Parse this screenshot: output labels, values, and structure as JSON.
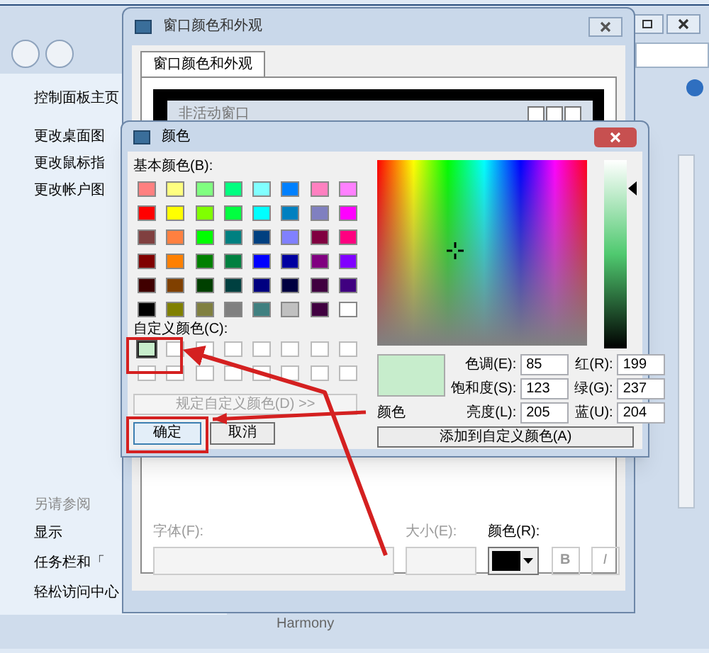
{
  "control_panel": {
    "sidebar_links": [
      "控制面板主页",
      "更改桌面图",
      "更改鼠标指",
      "更改帐户图"
    ],
    "see_also_title": "另请参阅",
    "see_also_links": [
      "显示",
      "任务栏和「",
      "轻松访问中心"
    ],
    "theme_name": "Harmony"
  },
  "appearance_dialog": {
    "title": "窗口颜色和外观",
    "tabs": [
      {
        "label": "窗口颜色和外观",
        "selected": true
      }
    ],
    "preview_window_title": "非活动窗口",
    "font_label": "字体(F):",
    "size_label": "大小(E):",
    "color_label": "颜色(R):",
    "bold_button": "B",
    "italic_button": "I"
  },
  "color_dialog": {
    "title": "颜色",
    "basic_colors_label": "基本颜色(B):",
    "basic_colors": [
      {
        "color": "#ff8080"
      },
      {
        "color": "#ffff80"
      },
      {
        "color": "#80ff80"
      },
      {
        "color": "#00ff80"
      },
      {
        "color": "#80ffff"
      },
      {
        "color": "#0080ff"
      },
      {
        "color": "#ff80c0"
      },
      {
        "color": "#ff80ff"
      },
      {
        "color": "#ff0000"
      },
      {
        "color": "#ffff00"
      },
      {
        "color": "#80ff00"
      },
      {
        "color": "#00ff40"
      },
      {
        "color": "#00ffff"
      },
      {
        "color": "#0080c0"
      },
      {
        "color": "#8080c0"
      },
      {
        "color": "#ff00ff"
      },
      {
        "color": "#804040"
      },
      {
        "color": "#ff8040"
      },
      {
        "color": "#00ff00"
      },
      {
        "color": "#008080"
      },
      {
        "color": "#004080"
      },
      {
        "color": "#8080ff"
      },
      {
        "color": "#800040"
      },
      {
        "color": "#ff0080"
      },
      {
        "color": "#800000"
      },
      {
        "color": "#ff8000"
      },
      {
        "color": "#008000"
      },
      {
        "color": "#008040"
      },
      {
        "color": "#0000ff"
      },
      {
        "color": "#0000a0"
      },
      {
        "color": "#800080"
      },
      {
        "color": "#8000ff"
      },
      {
        "color": "#400000"
      },
      {
        "color": "#804000"
      },
      {
        "color": "#004000"
      },
      {
        "color": "#004040"
      },
      {
        "color": "#000080"
      },
      {
        "color": "#000040"
      },
      {
        "color": "#400040"
      },
      {
        "color": "#400080"
      },
      {
        "color": "#000000"
      },
      {
        "color": "#808000"
      },
      {
        "color": "#808040"
      },
      {
        "color": "#808080"
      },
      {
        "color": "#408080"
      },
      {
        "color": "#c0c0c0"
      },
      {
        "color": "#400040"
      },
      {
        "color": "#ffffff"
      }
    ],
    "custom_colors_label": "自定义颜色(C):",
    "custom_colors": [
      {
        "color": "#c7edcc",
        "selected": true
      },
      {
        "color": "#ffffff",
        "selected": false
      },
      {
        "color": "#ffffff",
        "selected": false
      },
      {
        "color": "#ffffff",
        "selected": false
      },
      {
        "color": "#ffffff",
        "selected": false
      },
      {
        "color": "#ffffff",
        "selected": false
      },
      {
        "color": "#ffffff",
        "selected": false
      },
      {
        "color": "#ffffff",
        "selected": false
      },
      {
        "color": "#ffffff",
        "selected": false
      },
      {
        "color": "#ffffff",
        "selected": false
      },
      {
        "color": "#ffffff",
        "selected": false
      },
      {
        "color": "#ffffff",
        "selected": false
      },
      {
        "color": "#ffffff",
        "selected": false
      },
      {
        "color": "#ffffff",
        "selected": false
      },
      {
        "color": "#ffffff",
        "selected": false
      },
      {
        "color": "#ffffff",
        "selected": false
      }
    ],
    "define_custom_button": {
      "label": "规定自定义颜色(D) >>",
      "disabled": true
    },
    "ok_button": "确定",
    "cancel_button": "取消",
    "luminance_slider": {
      "level": 0.85
    },
    "preview_label": "颜色",
    "fields": [
      {
        "label": "色调(E):",
        "value": "85"
      },
      {
        "label": "红(R):",
        "value": "199"
      },
      {
        "label": "饱和度(S):",
        "value": "123"
      },
      {
        "label": "绿(G):",
        "value": "237"
      },
      {
        "label": "亮度(L):",
        "value": "205"
      },
      {
        "label": "蓝(U):",
        "value": "204"
      }
    ],
    "add_button": "添加到自定义颜色(A)"
  }
}
